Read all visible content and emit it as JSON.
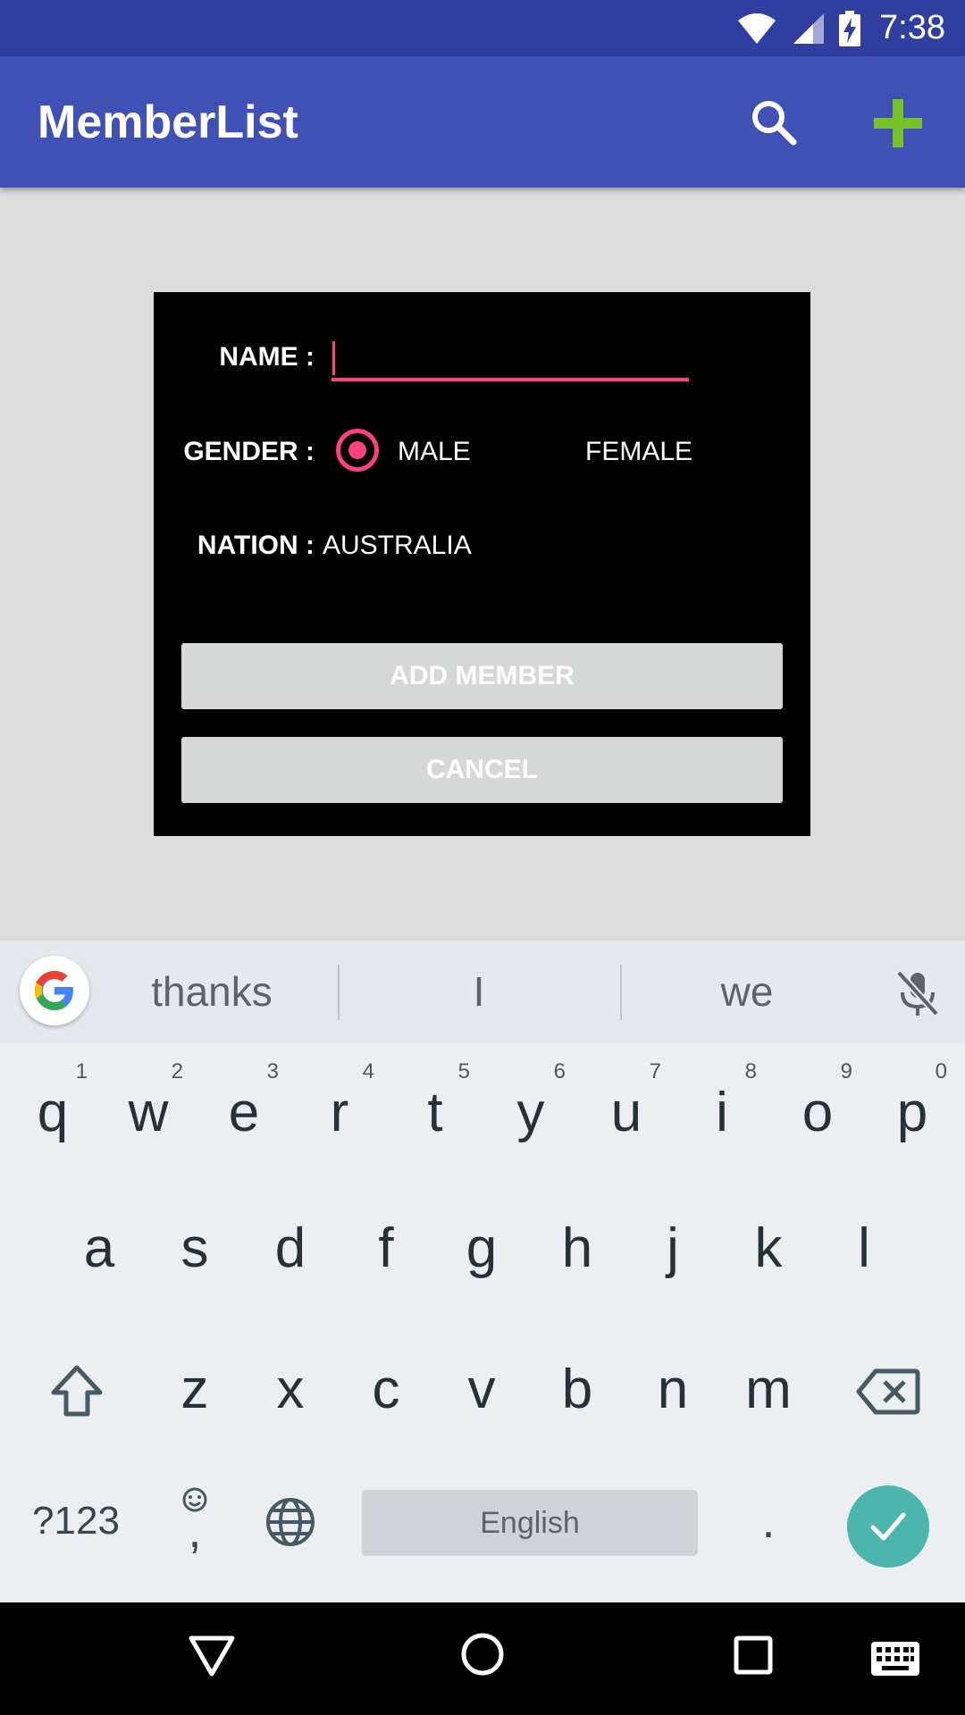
{
  "status_bar": {
    "time": "7:38",
    "icons": [
      "wifi-icon",
      "signal-icon",
      "battery-charging-icon"
    ]
  },
  "app_bar": {
    "title": "MemberList",
    "icons": [
      "search-icon",
      "add-icon"
    ],
    "add_color": "#76c22a"
  },
  "dialog": {
    "name_label": "NAME :",
    "name_value": "",
    "gender_label": "GENDER :",
    "gender_options": [
      "MALE",
      "FEMALE"
    ],
    "gender_selected": "MALE",
    "nation_label": "NATION :",
    "nation_value": "AUSTRALIA",
    "add_button": "ADD MEMBER",
    "cancel_button": "CANCEL",
    "accent_color": "#ff4081"
  },
  "keyboard": {
    "suggestions": [
      "thanks",
      "I",
      "we"
    ],
    "row1": [
      "q",
      "w",
      "e",
      "r",
      "t",
      "y",
      "u",
      "i",
      "o",
      "p"
    ],
    "row1_hints": [
      "1",
      "2",
      "3",
      "4",
      "5",
      "6",
      "7",
      "8",
      "9",
      "0"
    ],
    "row2": [
      "a",
      "s",
      "d",
      "f",
      "g",
      "h",
      "j",
      "k",
      "l"
    ],
    "row3": [
      "z",
      "x",
      "c",
      "v",
      "b",
      "n",
      "m"
    ],
    "symbols_key": "?123",
    "comma_key": ",",
    "space_label": "English",
    "period_key": ".",
    "icons": [
      "google-icon",
      "mic-off-icon",
      "shift-icon",
      "backspace-icon",
      "emoji-icon",
      "globe-icon",
      "check-icon",
      "keyboard-icon"
    ],
    "enter_color": "#4db6ac"
  },
  "nav_bar": {
    "icons": [
      "back-icon",
      "home-icon",
      "recents-icon",
      "keyboard-icon"
    ]
  }
}
